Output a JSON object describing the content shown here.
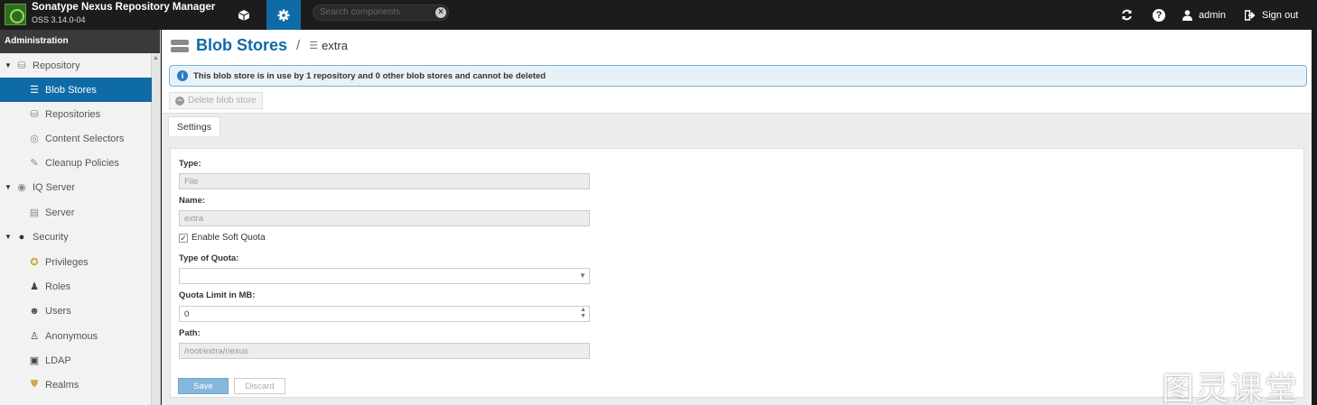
{
  "header": {
    "app_title": "Sonatype Nexus Repository Manager",
    "app_version": "OSS 3.14.0-04",
    "search_placeholder": "Search components",
    "user": "admin",
    "signout": "Sign out"
  },
  "sidebar": {
    "heading": "Administration",
    "items": [
      {
        "label": "Repository",
        "icon": "database-icon",
        "type": "group"
      },
      {
        "label": "Blob Stores",
        "icon": "blobstore-icon",
        "type": "child",
        "active": true
      },
      {
        "label": "Repositories",
        "icon": "database-icon",
        "type": "child"
      },
      {
        "label": "Content Selectors",
        "icon": "content-selector-icon",
        "type": "child"
      },
      {
        "label": "Cleanup Policies",
        "icon": "brush-icon",
        "type": "child"
      },
      {
        "label": "IQ Server",
        "icon": "iq-icon",
        "type": "group"
      },
      {
        "label": "Server",
        "icon": "server-icon",
        "type": "child"
      },
      {
        "label": "Security",
        "icon": "eye-icon",
        "type": "group"
      },
      {
        "label": "Privileges",
        "icon": "medal-icon",
        "type": "child"
      },
      {
        "label": "Roles",
        "icon": "role-icon",
        "type": "child"
      },
      {
        "label": "Users",
        "icon": "users-icon",
        "type": "child"
      },
      {
        "label": "Anonymous",
        "icon": "user-icon",
        "type": "child"
      },
      {
        "label": "LDAP",
        "icon": "book-icon",
        "type": "child"
      },
      {
        "label": "Realms",
        "icon": "shield-icon",
        "type": "child"
      }
    ]
  },
  "main": {
    "title": "Blob Stores",
    "crumb": "extra",
    "info_banner": "This blob store is in use by 1 repository and 0 other blob stores and cannot be deleted",
    "delete_button": "Delete blob store",
    "tab": "Settings",
    "form": {
      "type_label": "Type:",
      "type_value": "File",
      "name_label": "Name:",
      "name_value": "extra",
      "soft_quota_label": "Enable Soft Quota",
      "soft_quota_checked": "✓",
      "quota_type_label": "Type of Quota:",
      "quota_type_value": "",
      "quota_limit_label": "Quota Limit in MB:",
      "quota_limit_value": "0",
      "path_label": "Path:",
      "path_value": "/root/extra/nexus",
      "save": "Save",
      "discard": "Discard"
    }
  },
  "watermark": "图灵课堂",
  "colors": {
    "accent": "#0f6aa8",
    "topbar": "#1c1c1c",
    "banner": "#e8f1f8"
  }
}
